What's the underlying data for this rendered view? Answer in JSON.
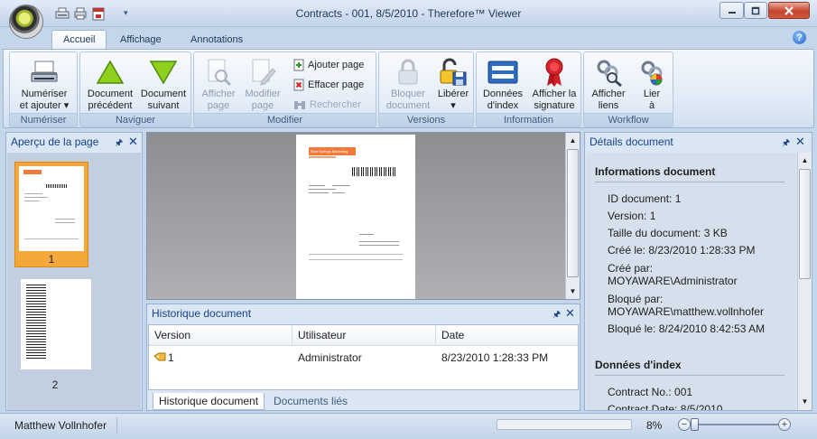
{
  "window": {
    "title": "Contracts - 001, 8/5/2010 - Therefore™ Viewer"
  },
  "ribbon": {
    "tabs": [
      "Accueil",
      "Affichage",
      "Annotations"
    ],
    "groups": {
      "numeriser": {
        "label": "Numériser",
        "btn_line1": "Numériser",
        "btn_line2": "et ajouter",
        "dropdown": "▾"
      },
      "naviguer": {
        "label": "Naviguer",
        "prev_line1": "Document",
        "prev_line2": "précédent",
        "next_line1": "Document",
        "next_line2": "suivant"
      },
      "modifier": {
        "label": "Modifier",
        "show_line1": "Afficher",
        "show_line2": "page",
        "edit_line1": "Modifier",
        "edit_line2": "page",
        "add_page": "Ajouter page",
        "delete_page": "Effacer page",
        "search": "Rechercher"
      },
      "versions": {
        "label": "Versions",
        "lock_line1": "Bloquer",
        "lock_line2": "document",
        "release_line1": "Libérer",
        "dropdown": "▾"
      },
      "information": {
        "label": "Information",
        "index_line1": "Données",
        "index_line2": "d'index",
        "sig_line1": "Afficher la",
        "sig_line2": "signature"
      },
      "workflow": {
        "label": "Workflow",
        "links_line1": "Afficher",
        "links_line2": "liens",
        "link_line1": "Lier",
        "link_line2": "à"
      }
    }
  },
  "left_panel": {
    "title": "Aperçu de la page",
    "pages": [
      "1",
      "2"
    ]
  },
  "viewer": {
    "page_header": "Blue Springs Marketing"
  },
  "history_panel": {
    "title": "Historique document",
    "columns": [
      "Version",
      "Utilisateur",
      "Date"
    ],
    "rows": [
      {
        "version": "1",
        "user": "Administrator",
        "date": "8/23/2010 1:28:33 PM"
      }
    ],
    "tabs": [
      "Historique document",
      "Documents liés"
    ]
  },
  "right_panel": {
    "title": "Détails document",
    "info_title": "Informations document",
    "info": [
      "ID document: 1",
      "Version: 1",
      "Taille du document: 3 KB",
      "Créé le: 8/23/2010 1:28:33 PM",
      "Créé par:",
      "MOYAWARE\\Administrator",
      "Bloqué par:",
      "MOYAWARE\\matthew.vollnhofer",
      "Bloqué le: 8/24/2010 8:42:53 AM"
    ],
    "index_title": "Données d'index",
    "index": [
      "Contract No.:  001",
      "Contract Date:  8/5/2010"
    ]
  },
  "status_bar": {
    "user": "Matthew Vollnhofer",
    "zoom": "8%",
    "zoom_minus": "−",
    "zoom_plus": "+"
  },
  "colors": {
    "accent": "#15428b",
    "selection": "#f4a73a",
    "arrow_green": "#8fd01e"
  }
}
